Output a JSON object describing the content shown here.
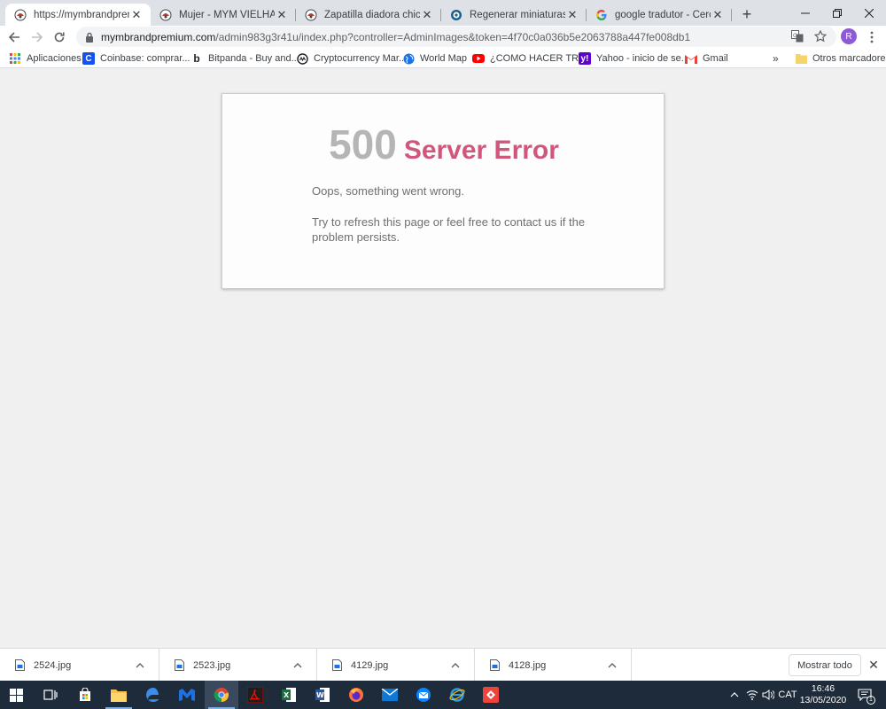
{
  "browser": {
    "tabs": [
      {
        "title": "https://mymbrandpremium",
        "icon": "site-favicon-icon",
        "active": true
      },
      {
        "title": "Mujer - MYM VIELHA SCP",
        "icon": "site-favicon-icon",
        "active": false
      },
      {
        "title": "Zapatilla diadora chica - M",
        "icon": "site-favicon-icon",
        "active": false
      },
      {
        "title": "Regenerar miniaturas de la",
        "icon": "prestashop-icon",
        "active": false
      },
      {
        "title": "google tradutor - Cerca am",
        "icon": "google-icon",
        "active": false
      }
    ],
    "address": {
      "host": "mymbrandpremium.com",
      "path": "/admin983g3r41u/index.php?controller=AdminImages&token=4f70c0a036b5e2063788a447fe008db1"
    },
    "profile_initial": "R",
    "bookmarks": [
      {
        "label": "Aplicaciones",
        "icon": "apps-grid-icon"
      },
      {
        "label": "Coinbase: comprar...",
        "icon": "coinbase-icon"
      },
      {
        "label": "Bitpanda - Buy and...",
        "icon": "bitpanda-icon"
      },
      {
        "label": "Cryptocurrency Mar...",
        "icon": "coinmarketcap-icon"
      },
      {
        "label": "World Map",
        "icon": "globe-icon"
      },
      {
        "label": "¿COMO HACER TR...",
        "icon": "youtube-icon"
      },
      {
        "label": "Yahoo - inicio de se...",
        "icon": "yahoo-icon"
      },
      {
        "label": "Gmail",
        "icon": "gmail-icon"
      }
    ],
    "bookmarks_overflow": "»",
    "other_bookmarks": "Otros marcadores"
  },
  "page": {
    "error_code": "500",
    "error_title": "Server Error",
    "message_line1": "Oops, something went wrong.",
    "message_line2": "Try to refresh this page or feel free to contact us if the problem persists."
  },
  "downloads": {
    "items": [
      {
        "name": "2524.jpg"
      },
      {
        "name": "2523.jpg"
      },
      {
        "name": "4129.jpg"
      },
      {
        "name": "4128.jpg"
      }
    ],
    "show_all_label": "Mostrar todo"
  },
  "taskbar": {
    "language": "CAT",
    "time": "16:46",
    "date": "13/05/2020",
    "notification_count": "1"
  },
  "colors": {
    "error_code": "#b5b5b5",
    "error_title": "#d0577b",
    "taskbar": "#1d2b3a"
  }
}
